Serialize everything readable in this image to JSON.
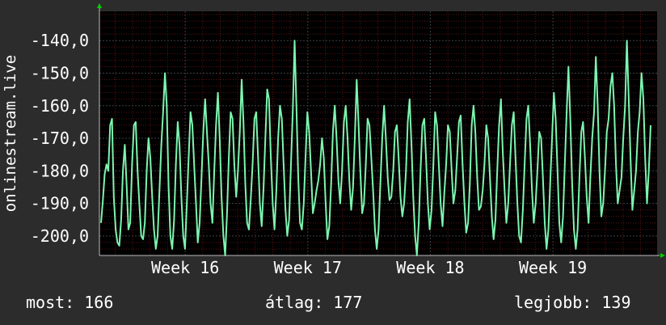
{
  "chart_data": {
    "type": "line",
    "ylabel": "onlinestream.live",
    "y_ticks": [
      "-140,0",
      "-150,0",
      "-160,0",
      "-170,0",
      "-180,0",
      "-190,0",
      "-200,0"
    ],
    "y_tick_values": [
      -140,
      -150,
      -160,
      -170,
      -180,
      -190,
      -200
    ],
    "ylim": [
      -206,
      -131
    ],
    "x_ticks": [
      "Week 16",
      "Week 17",
      "Week 18",
      "Week 19"
    ],
    "x_tick_positions": [
      16,
      17,
      18,
      19
    ],
    "xlim": [
      15.3,
      19.85
    ],
    "grid": true,
    "series": [
      {
        "values": [
          -196,
          -189,
          -181,
          -178,
          -180,
          -166,
          -164,
          -188,
          -198,
          -202,
          -203,
          -195,
          -180,
          -172,
          -184,
          -198,
          -196,
          -178,
          -166,
          -165,
          -180,
          -190,
          -200,
          -201,
          -196,
          -180,
          -170,
          -176,
          -188,
          -198,
          -204,
          -200,
          -186,
          -172,
          -162,
          -150,
          -160,
          -185,
          -200,
          -204,
          -195,
          -178,
          -165,
          -172,
          -188,
          -200,
          -204,
          -190,
          -176,
          -162,
          -166,
          -178,
          -190,
          -202,
          -196,
          -182,
          -168,
          -158,
          -168,
          -178,
          -190,
          -196,
          -180,
          -166,
          -156,
          -170,
          -188,
          -200,
          -206,
          -193,
          -176,
          -162,
          -164,
          -178,
          -188,
          -180,
          -168,
          -152,
          -165,
          -184,
          -196,
          -198,
          -189,
          -178,
          -164,
          -162,
          -176,
          -190,
          -197,
          -185,
          -170,
          -155,
          -158,
          -176,
          -190,
          -198,
          -186,
          -170,
          -160,
          -164,
          -178,
          -192,
          -200,
          -195,
          -178,
          -162,
          -140,
          -160,
          -182,
          -196,
          -198,
          -190,
          -176,
          -162,
          -168,
          -180,
          -193,
          -190,
          -186,
          -183,
          -178,
          -170,
          -176,
          -190,
          -201,
          -197,
          -184,
          -168,
          -160,
          -170,
          -183,
          -190,
          -180,
          -165,
          -160,
          -170,
          -183,
          -192,
          -185,
          -170,
          -152,
          -165,
          -180,
          -193,
          -190,
          -178,
          -164,
          -166,
          -176,
          -186,
          -198,
          -204,
          -198,
          -184,
          -170,
          -160,
          -170,
          -182,
          -189,
          -188,
          -180,
          -168,
          -166,
          -176,
          -188,
          -194,
          -190,
          -180,
          -165,
          -158,
          -172,
          -188,
          -200,
          -206,
          -196,
          -180,
          -166,
          -164,
          -176,
          -190,
          -198,
          -192,
          -178,
          -162,
          -166,
          -178,
          -190,
          -197,
          -187,
          -178,
          -166,
          -168,
          -180,
          -190,
          -186,
          -176,
          -165,
          -163,
          -178,
          -190,
          -199,
          -196,
          -184,
          -166,
          -160,
          -168,
          -182,
          -192,
          -191,
          -186,
          -178,
          -166,
          -170,
          -182,
          -194,
          -201,
          -195,
          -180,
          -166,
          -158,
          -174,
          -186,
          -196,
          -190,
          -178,
          -166,
          -162,
          -176,
          -190,
          -200,
          -202,
          -192,
          -178,
          -164,
          -160,
          -172,
          -186,
          -196,
          -190,
          -180,
          -168,
          -170,
          -182,
          -196,
          -204,
          -198,
          -184,
          -170,
          -156,
          -164,
          -180,
          -196,
          -202,
          -194,
          -178,
          -162,
          -148,
          -164,
          -184,
          -198,
          -204,
          -198,
          -182,
          -168,
          -165,
          -176,
          -188,
          -196,
          -182,
          -170,
          -162,
          -145,
          -160,
          -180,
          -194,
          -190,
          -180,
          -168,
          -164,
          -154,
          -150,
          -160,
          -178,
          -190,
          -186,
          -182,
          -170,
          -160,
          -140,
          -158,
          -176,
          -192,
          -186,
          -180,
          -168,
          -162,
          -150,
          -158,
          -176,
          -190,
          -180,
          -166
        ]
      }
    ]
  },
  "legend": {
    "now": "most: 166",
    "avg": "átlag: 177",
    "best": "legjobb: 139"
  },
  "colors": {
    "background": "#2c2c2c",
    "plot_background": "#000000",
    "line": "#7cf5b0",
    "grid_minor": "#5a1414",
    "grid_major": "#404040",
    "axis_arrow": "#00d000",
    "text": "#ffffff"
  }
}
